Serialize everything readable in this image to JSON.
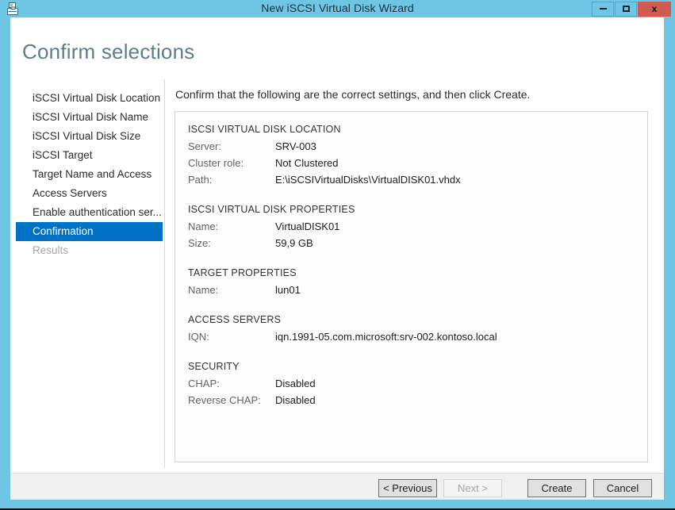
{
  "window": {
    "title": "New iSCSI Virtual Disk Wizard",
    "icon": "iscsi-disk-wizard-icon",
    "accent_color": "#6ec6e4",
    "close_color": "#cf5b52",
    "controls": {
      "minimize": "minimize-icon",
      "maximize": "maximize-icon",
      "close": "x"
    }
  },
  "page": {
    "heading": "Confirm selections",
    "instruction": "Confirm that the following are the correct settings, and then click Create."
  },
  "sidebar": {
    "selected_color": "#0072c6",
    "items": [
      {
        "label": "iSCSI Virtual Disk Location",
        "state": "normal"
      },
      {
        "label": "iSCSI Virtual Disk Name",
        "state": "normal"
      },
      {
        "label": "iSCSI Virtual Disk Size",
        "state": "normal"
      },
      {
        "label": "iSCSI Target",
        "state": "normal"
      },
      {
        "label": "Target Name and Access",
        "state": "normal"
      },
      {
        "label": "Access Servers",
        "state": "normal"
      },
      {
        "label": "Enable authentication ser...",
        "state": "normal"
      },
      {
        "label": "Confirmation",
        "state": "selected"
      },
      {
        "label": "Results",
        "state": "disabled"
      }
    ]
  },
  "details": {
    "sections": [
      {
        "title": "ISCSI VIRTUAL DISK LOCATION",
        "rows": [
          {
            "label": "Server:",
            "value": "SRV-003"
          },
          {
            "label": "Cluster role:",
            "value": "Not Clustered"
          },
          {
            "label": "Path:",
            "value": "E:\\iSCSIVirtualDisks\\VirtualDISK01.vhdx"
          }
        ]
      },
      {
        "title": "ISCSI VIRTUAL DISK PROPERTIES",
        "rows": [
          {
            "label": "Name:",
            "value": "VirtualDISK01"
          },
          {
            "label": "Size:",
            "value": "59,9 GB"
          }
        ]
      },
      {
        "title": "TARGET PROPERTIES",
        "rows": [
          {
            "label": "Name:",
            "value": "lun01"
          }
        ]
      },
      {
        "title": "ACCESS SERVERS",
        "rows": [
          {
            "label": "IQN:",
            "value": "iqn.1991-05.com.microsoft:srv-002.kontoso.local"
          }
        ]
      },
      {
        "title": "SECURITY",
        "rows": [
          {
            "label": "CHAP:",
            "value": "Disabled"
          },
          {
            "label": "Reverse CHAP:",
            "value": "Disabled"
          }
        ]
      }
    ]
  },
  "footer": {
    "buttons": [
      {
        "label": "< Previous",
        "state": "enabled"
      },
      {
        "label": "Next >",
        "state": "disabled"
      },
      {
        "label": "Create",
        "state": "enabled"
      },
      {
        "label": "Cancel",
        "state": "enabled"
      }
    ]
  }
}
